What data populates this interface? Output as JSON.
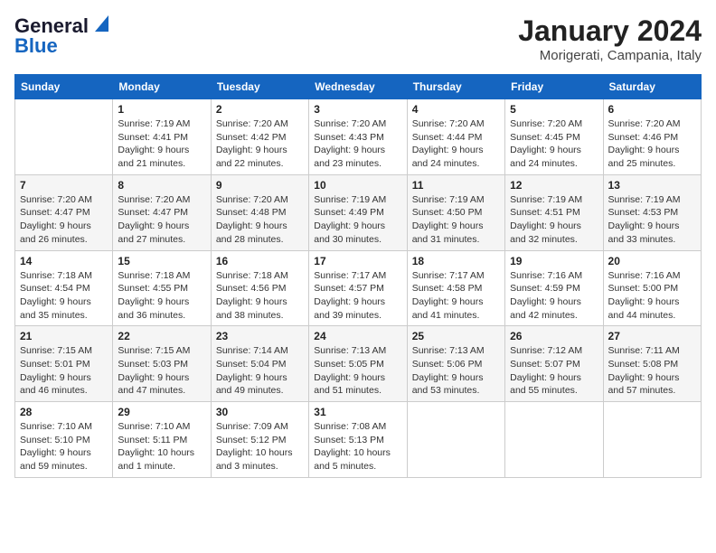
{
  "header": {
    "logo_line1": "General",
    "logo_line2": "Blue",
    "month": "January 2024",
    "location": "Morigerati, Campania, Italy"
  },
  "weekdays": [
    "Sunday",
    "Monday",
    "Tuesday",
    "Wednesday",
    "Thursday",
    "Friday",
    "Saturday"
  ],
  "weeks": [
    [
      {
        "day": "",
        "sunrise": "",
        "sunset": "",
        "daylight": ""
      },
      {
        "day": "1",
        "sunrise": "Sunrise: 7:19 AM",
        "sunset": "Sunset: 4:41 PM",
        "daylight": "Daylight: 9 hours and 21 minutes."
      },
      {
        "day": "2",
        "sunrise": "Sunrise: 7:20 AM",
        "sunset": "Sunset: 4:42 PM",
        "daylight": "Daylight: 9 hours and 22 minutes."
      },
      {
        "day": "3",
        "sunrise": "Sunrise: 7:20 AM",
        "sunset": "Sunset: 4:43 PM",
        "daylight": "Daylight: 9 hours and 23 minutes."
      },
      {
        "day": "4",
        "sunrise": "Sunrise: 7:20 AM",
        "sunset": "Sunset: 4:44 PM",
        "daylight": "Daylight: 9 hours and 24 minutes."
      },
      {
        "day": "5",
        "sunrise": "Sunrise: 7:20 AM",
        "sunset": "Sunset: 4:45 PM",
        "daylight": "Daylight: 9 hours and 24 minutes."
      },
      {
        "day": "6",
        "sunrise": "Sunrise: 7:20 AM",
        "sunset": "Sunset: 4:46 PM",
        "daylight": "Daylight: 9 hours and 25 minutes."
      }
    ],
    [
      {
        "day": "7",
        "sunrise": "Sunrise: 7:20 AM",
        "sunset": "Sunset: 4:47 PM",
        "daylight": "Daylight: 9 hours and 26 minutes."
      },
      {
        "day": "8",
        "sunrise": "Sunrise: 7:20 AM",
        "sunset": "Sunset: 4:47 PM",
        "daylight": "Daylight: 9 hours and 27 minutes."
      },
      {
        "day": "9",
        "sunrise": "Sunrise: 7:20 AM",
        "sunset": "Sunset: 4:48 PM",
        "daylight": "Daylight: 9 hours and 28 minutes."
      },
      {
        "day": "10",
        "sunrise": "Sunrise: 7:19 AM",
        "sunset": "Sunset: 4:49 PM",
        "daylight": "Daylight: 9 hours and 30 minutes."
      },
      {
        "day": "11",
        "sunrise": "Sunrise: 7:19 AM",
        "sunset": "Sunset: 4:50 PM",
        "daylight": "Daylight: 9 hours and 31 minutes."
      },
      {
        "day": "12",
        "sunrise": "Sunrise: 7:19 AM",
        "sunset": "Sunset: 4:51 PM",
        "daylight": "Daylight: 9 hours and 32 minutes."
      },
      {
        "day": "13",
        "sunrise": "Sunrise: 7:19 AM",
        "sunset": "Sunset: 4:53 PM",
        "daylight": "Daylight: 9 hours and 33 minutes."
      }
    ],
    [
      {
        "day": "14",
        "sunrise": "Sunrise: 7:18 AM",
        "sunset": "Sunset: 4:54 PM",
        "daylight": "Daylight: 9 hours and 35 minutes."
      },
      {
        "day": "15",
        "sunrise": "Sunrise: 7:18 AM",
        "sunset": "Sunset: 4:55 PM",
        "daylight": "Daylight: 9 hours and 36 minutes."
      },
      {
        "day": "16",
        "sunrise": "Sunrise: 7:18 AM",
        "sunset": "Sunset: 4:56 PM",
        "daylight": "Daylight: 9 hours and 38 minutes."
      },
      {
        "day": "17",
        "sunrise": "Sunrise: 7:17 AM",
        "sunset": "Sunset: 4:57 PM",
        "daylight": "Daylight: 9 hours and 39 minutes."
      },
      {
        "day": "18",
        "sunrise": "Sunrise: 7:17 AM",
        "sunset": "Sunset: 4:58 PM",
        "daylight": "Daylight: 9 hours and 41 minutes."
      },
      {
        "day": "19",
        "sunrise": "Sunrise: 7:16 AM",
        "sunset": "Sunset: 4:59 PM",
        "daylight": "Daylight: 9 hours and 42 minutes."
      },
      {
        "day": "20",
        "sunrise": "Sunrise: 7:16 AM",
        "sunset": "Sunset: 5:00 PM",
        "daylight": "Daylight: 9 hours and 44 minutes."
      }
    ],
    [
      {
        "day": "21",
        "sunrise": "Sunrise: 7:15 AM",
        "sunset": "Sunset: 5:01 PM",
        "daylight": "Daylight: 9 hours and 46 minutes."
      },
      {
        "day": "22",
        "sunrise": "Sunrise: 7:15 AM",
        "sunset": "Sunset: 5:03 PM",
        "daylight": "Daylight: 9 hours and 47 minutes."
      },
      {
        "day": "23",
        "sunrise": "Sunrise: 7:14 AM",
        "sunset": "Sunset: 5:04 PM",
        "daylight": "Daylight: 9 hours and 49 minutes."
      },
      {
        "day": "24",
        "sunrise": "Sunrise: 7:13 AM",
        "sunset": "Sunset: 5:05 PM",
        "daylight": "Daylight: 9 hours and 51 minutes."
      },
      {
        "day": "25",
        "sunrise": "Sunrise: 7:13 AM",
        "sunset": "Sunset: 5:06 PM",
        "daylight": "Daylight: 9 hours and 53 minutes."
      },
      {
        "day": "26",
        "sunrise": "Sunrise: 7:12 AM",
        "sunset": "Sunset: 5:07 PM",
        "daylight": "Daylight: 9 hours and 55 minutes."
      },
      {
        "day": "27",
        "sunrise": "Sunrise: 7:11 AM",
        "sunset": "Sunset: 5:08 PM",
        "daylight": "Daylight: 9 hours and 57 minutes."
      }
    ],
    [
      {
        "day": "28",
        "sunrise": "Sunrise: 7:10 AM",
        "sunset": "Sunset: 5:10 PM",
        "daylight": "Daylight: 9 hours and 59 minutes."
      },
      {
        "day": "29",
        "sunrise": "Sunrise: 7:10 AM",
        "sunset": "Sunset: 5:11 PM",
        "daylight": "Daylight: 10 hours and 1 minute."
      },
      {
        "day": "30",
        "sunrise": "Sunrise: 7:09 AM",
        "sunset": "Sunset: 5:12 PM",
        "daylight": "Daylight: 10 hours and 3 minutes."
      },
      {
        "day": "31",
        "sunrise": "Sunrise: 7:08 AM",
        "sunset": "Sunset: 5:13 PM",
        "daylight": "Daylight: 10 hours and 5 minutes."
      },
      {
        "day": "",
        "sunrise": "",
        "sunset": "",
        "daylight": ""
      },
      {
        "day": "",
        "sunrise": "",
        "sunset": "",
        "daylight": ""
      },
      {
        "day": "",
        "sunrise": "",
        "sunset": "",
        "daylight": ""
      }
    ]
  ]
}
